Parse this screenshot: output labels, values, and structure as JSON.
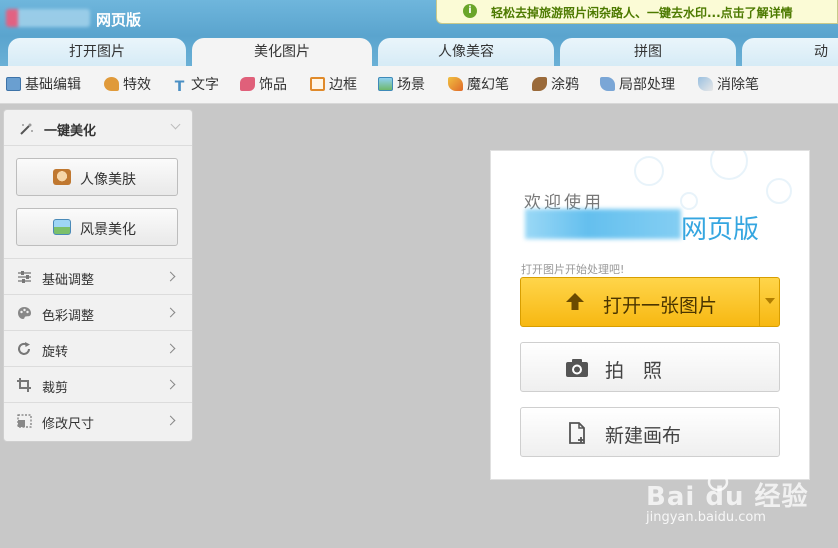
{
  "app": {
    "title": "网页版"
  },
  "promo": {
    "text": "轻松去掉旅游照片闲杂路人、一键去水印...点击了解详情",
    "icon": "info-icon"
  },
  "tabs": [
    {
      "label": "打开图片",
      "active": false
    },
    {
      "label": "美化图片",
      "active": true
    },
    {
      "label": "人像美容",
      "active": false
    },
    {
      "label": "拼图",
      "active": false
    },
    {
      "label": "动画",
      "active": false
    }
  ],
  "toolbar": {
    "items": [
      {
        "label": "基础编辑",
        "icon": "basic-edit-icon"
      },
      {
        "label": "特效",
        "icon": "effects-icon"
      },
      {
        "label": "文字",
        "icon": "text-icon"
      },
      {
        "label": "饰品",
        "icon": "accessory-icon"
      },
      {
        "label": "边框",
        "icon": "frame-icon"
      },
      {
        "label": "场景",
        "icon": "scene-icon"
      },
      {
        "label": "魔幻笔",
        "icon": "magic-pen-icon"
      },
      {
        "label": "涂鸦",
        "icon": "doodle-icon"
      },
      {
        "label": "局部处理",
        "icon": "local-adjust-icon"
      },
      {
        "label": "消除笔",
        "icon": "eraser-pen-icon"
      }
    ]
  },
  "sidebar": {
    "header": "一键美化",
    "buttons": [
      {
        "label": "人像美肤",
        "icon": "portrait-icon"
      },
      {
        "label": "风景美化",
        "icon": "landscape-icon"
      }
    ],
    "items": [
      {
        "label": "基础调整",
        "icon": "sliders-icon"
      },
      {
        "label": "色彩调整",
        "icon": "palette-icon"
      },
      {
        "label": "旋转",
        "icon": "rotate-icon"
      },
      {
        "label": "裁剪",
        "icon": "crop-icon"
      },
      {
        "label": "修改尺寸",
        "icon": "resize-icon"
      }
    ]
  },
  "welcome": {
    "greeting": "欢迎使用",
    "brand_suffix": "网页版",
    "hint": "打开图片开始处理吧!",
    "open_label": "打开一张图片",
    "photo_label": "拍　照",
    "new_canvas_label": "新建画布"
  },
  "watermark": {
    "logo": "Bai du 经验",
    "url": "jingyan.baidu.com"
  },
  "colors": {
    "accent_blue": "#5aa4ce",
    "open_button": "#f7b812",
    "brand_blue": "#35a6e0"
  }
}
